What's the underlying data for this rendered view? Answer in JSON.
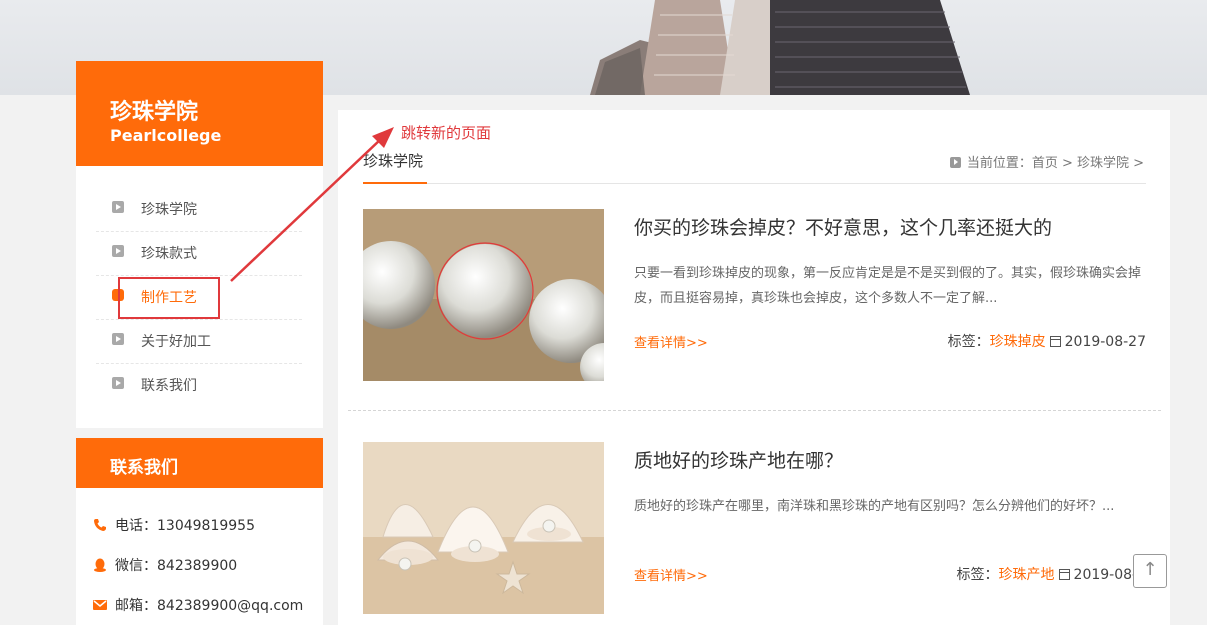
{
  "sidebar": {
    "title": "珍珠学院",
    "subtitle": "Pearlcollege",
    "items": [
      {
        "label": "珍珠学院",
        "active": false
      },
      {
        "label": "珍珠款式",
        "active": false
      },
      {
        "label": "制作工艺",
        "active": true
      },
      {
        "label": "关于好加工",
        "active": false
      },
      {
        "label": "联系我们",
        "active": false
      }
    ]
  },
  "contact": {
    "title": "联系我们",
    "phone": "电话：13049819955",
    "wechat": "微信：842389900",
    "email": "邮箱：842389900@qq.com"
  },
  "main": {
    "title": "珍珠学院",
    "breadcrumb": "当前位置：首页 > 珍珠学院 >",
    "articles": [
      {
        "title": "你买的珍珠会掉皮？不好意思，这个几率还挺大的",
        "summary": "只要一看到珍珠掉皮的现象，第一反应肯定是是不是买到假的了。其实，假珍珠确实会掉皮，而且挺容易掉，真珍珠也会掉皮，这个多数人不一定了解...",
        "more": "查看详情>>",
        "tag_label": "标签：",
        "tag": "珍珠掉皮",
        "date": "2019-08-27"
      },
      {
        "title": "质地好的珍珠产地在哪？",
        "summary": "质地好的珍珠产在哪里，南洋珠和黑珍珠的产地有区别吗？怎么分辨他们的好坏？...",
        "more": "查看详情>>",
        "tag_label": "标签：",
        "tag": "珍珠产地",
        "date": "2019-08-2"
      }
    ]
  },
  "annotation": {
    "text": "跳转新的页面",
    "color": "#e0393c"
  },
  "colors": {
    "accent": "#ff6b0a",
    "annotation": "#e0393c"
  },
  "icons": {
    "back_top": "↑"
  }
}
